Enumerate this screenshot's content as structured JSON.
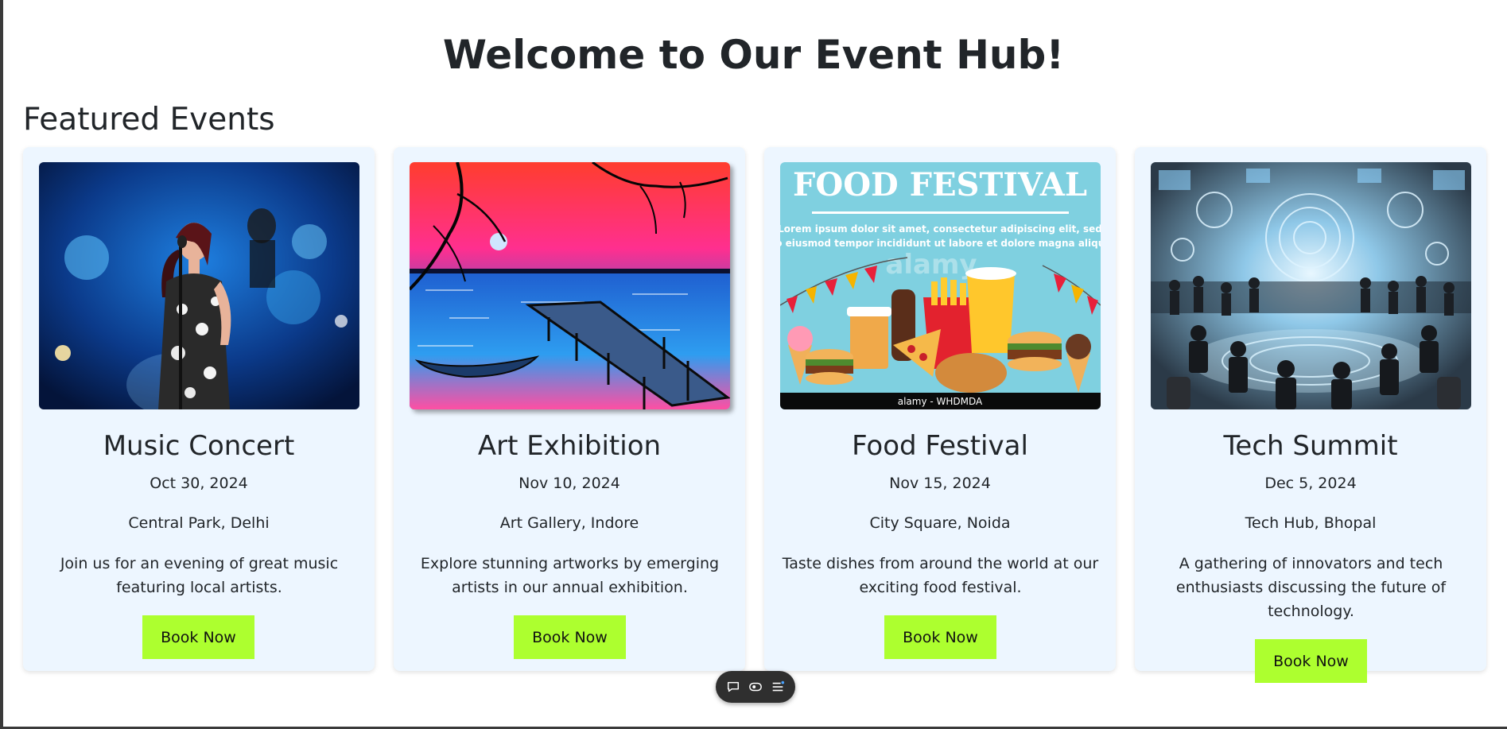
{
  "page": {
    "title": "Welcome to Our Event Hub!",
    "section_title": "Featured Events"
  },
  "events": [
    {
      "title": "Music Concert",
      "date": "Oct 30, 2024",
      "location": "Central Park, Delhi",
      "description": "Join us for an evening of great music featuring local artists.",
      "button": "Book Now"
    },
    {
      "title": "Art Exhibition",
      "date": "Nov 10, 2024",
      "location": "Art Gallery, Indore",
      "description": "Explore stunning artworks by emerging artists in our annual exhibition.",
      "button": "Book Now"
    },
    {
      "title": "Food Festival",
      "date": "Nov 15, 2024",
      "location": "City Square, Noida",
      "description": "Taste dishes from around the world at our exciting food festival.",
      "button": "Book Now",
      "image_text": {
        "headline": "FOOD FESTIVAL",
        "line1": "Lorem ipsum dolor sit amet, consectetur adipiscing elit, sed",
        "line2": "do eiusmod tempor incididunt ut labore et dolore magna aliqua",
        "watermark": "alamy",
        "credit": "alamy - WHDMDA"
      }
    },
    {
      "title": "Tech Summit",
      "date": "Dec 5, 2024",
      "location": "Tech Hub, Bhopal",
      "description": "A gathering of innovators and tech enthusiasts discussing the future of technology.",
      "button": "Book Now"
    }
  ],
  "toolbar": {
    "icons": [
      "comment-icon",
      "eye-icon",
      "menu-icon"
    ]
  },
  "colors": {
    "card_background": "#edf6ff",
    "button_background": "#adff2f",
    "text": "#212529"
  }
}
